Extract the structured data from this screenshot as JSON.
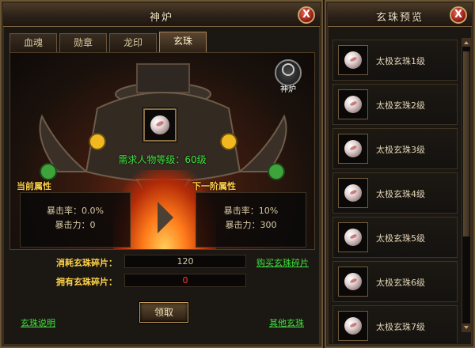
{
  "left_panel": {
    "title": "神炉",
    "close": "X",
    "tabs": [
      {
        "label": "血魂",
        "active": false
      },
      {
        "label": "勋章",
        "active": false
      },
      {
        "label": "龙印",
        "active": false
      },
      {
        "label": "玄珠",
        "active": true
      }
    ],
    "badge_label": "神炉",
    "requirement": "需求人物等级：60级",
    "current_attr": {
      "label": "当前属性",
      "crit_rate": "暴击率：0.0%",
      "crit_power": "暴击力：0"
    },
    "next_attr": {
      "label": "下一阶属性",
      "crit_rate": "暴击率：10%",
      "crit_power": "暴击力：300"
    },
    "consume_label": "消耗玄珠碎片：",
    "consume_value": "120",
    "own_label": "拥有玄珠碎片：",
    "own_value": "0",
    "buy_link": "购买玄珠碎片",
    "claim_button": "领取",
    "help_link": "玄珠说明",
    "other_link": "其他玄珠"
  },
  "right_panel": {
    "title": "玄珠预览",
    "close": "X",
    "items": [
      {
        "name": "太极玄珠1级"
      },
      {
        "name": "太极玄珠2级"
      },
      {
        "name": "太极玄珠3级"
      },
      {
        "name": "太极玄珠4级"
      },
      {
        "name": "太极玄珠5级"
      },
      {
        "name": "太极玄珠6级"
      },
      {
        "name": "太极玄珠7级"
      }
    ]
  },
  "colors": {
    "accent_green": "#3ee23e",
    "accent_gold": "#ffd24a",
    "value_red": "#ff3b3b"
  }
}
